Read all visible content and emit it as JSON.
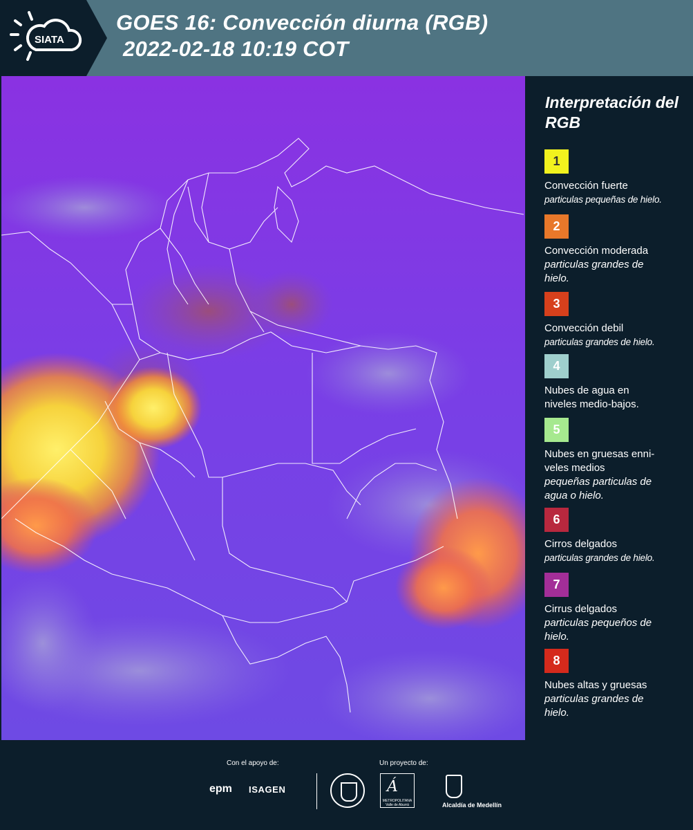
{
  "header": {
    "logo_text": "SIATA",
    "title_line1": "GOES 16: Convección diurna (RGB)",
    "title_line2": "2022-02-18 10:19 COT"
  },
  "legend": {
    "title": "Interpretación del RGB",
    "items": [
      {
        "number": "1",
        "color": "#f2f21e",
        "text_color": "#333333",
        "label": "Convección fuerte",
        "sub": "particulas pequeñas de hielo."
      },
      {
        "number": "2",
        "color": "#e8782a",
        "text_color": "#ffffff",
        "label": "Convección moderada",
        "sub": "particulas grandes de hielo."
      },
      {
        "number": "3",
        "color": "#d7401c",
        "text_color": "#ffffff",
        "label": "Convección debil",
        "sub": "particulas grandes de hielo."
      },
      {
        "number": "4",
        "color": "#9fcfcd",
        "text_color": "#ffffff",
        "label": "Nubes de agua en niveles medio-bajos.",
        "sub": ""
      },
      {
        "number": "5",
        "color": "#a6e98f",
        "text_color": "#ffffff",
        "label": "Nubes en gruesas enni-veles medios",
        "sub": "pequeñas particulas de agua o hielo."
      },
      {
        "number": "6",
        "color": "#b8283e",
        "text_color": "#ffffff",
        "label": "Cirros delgados",
        "sub": "particulas grandes de hielo."
      },
      {
        "number": "7",
        "color": "#a32e98",
        "text_color": "#ffffff",
        "label": "Cirrus delgados",
        "sub": "particulas pequeños de hielo."
      },
      {
        "number": "8",
        "color": "#d52a1c",
        "text_color": "#ffffff",
        "label": "Nubes altas y gruesas",
        "sub": "particulas grandes de hielo."
      }
    ]
  },
  "footer": {
    "support_label": "Con el apoyo de:",
    "project_label": "Un proyecto de:",
    "sponsor_1": "epm",
    "sponsor_2": "ISAGEN",
    "partner_area": "METROPOLITANA Valle de Aburrá",
    "partner_alcaldia": "Alcaldía de Medellín"
  }
}
